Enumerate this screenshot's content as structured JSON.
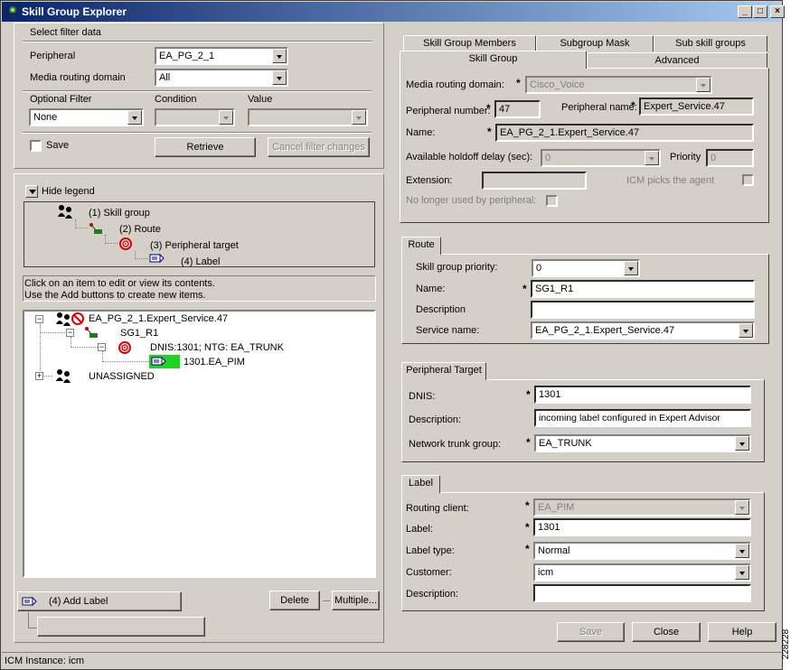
{
  "window": {
    "title": "Skill Group Explorer",
    "controls": [
      "_",
      "□",
      "×"
    ]
  },
  "filter": {
    "section_label": "Select filter data",
    "peripheral_label": "Peripheral",
    "peripheral_value": "EA_PG_2_1",
    "media_label": "Media routing domain",
    "media_value": "All",
    "optional_filter_label": "Optional Filter",
    "condition_label": "Condition",
    "value_label": "Value",
    "optional_filter_value": "None",
    "save_label": "Save",
    "retrieve_button": "Retrieve",
    "cancel_button": "Cancel filter changes"
  },
  "legend": {
    "toggle_label": "Hide legend",
    "items": [
      "(1) Skill group",
      "(2) Route",
      "(3) Peripheral target",
      "(4) Label"
    ]
  },
  "instructions": {
    "line1": "Click on an item to edit or view its contents.",
    "line2": "Use the Add buttons to create new items."
  },
  "tree": {
    "skill_group": "EA_PG_2_1.Expert_Service.47",
    "route": "SG1_R1",
    "peripheral_target": "DNIS:1301; NTG: EA_TRUNK",
    "label": "1301.EA_PIM",
    "unassigned": "UNASSIGNED"
  },
  "bottom_left": {
    "add_label_button": "(4) Add Label",
    "delete_button": "Delete",
    "multiple_button": "Multiple..."
  },
  "tabs": {
    "row1": [
      "Skill Group Members",
      "Subgroup Mask",
      "Sub skill groups"
    ],
    "row2": [
      "Skill Group",
      "Advanced"
    ]
  },
  "skill_group": {
    "media_label": "Media routing domain:",
    "media_value": "Cisco_Voice",
    "peripheral_number_label": "Peripheral number:",
    "peripheral_number_value": "47",
    "peripheral_name_label": "Peripheral name:",
    "peripheral_name_value": "Expert_Service.47",
    "name_label": "Name:",
    "name_value": "EA_PG_2_1.Expert_Service.47",
    "holdoff_label": "Available holdoff delay (sec):",
    "holdoff_value": "0",
    "priority_label": "Priority",
    "priority_value": "0",
    "extension_label": "Extension:",
    "icm_picks_label": "ICM picks the agent",
    "no_longer_label": "No longer used by peripheral:"
  },
  "route": {
    "tab_label": "Route",
    "priority_label": "Skill group priority:",
    "priority_value": "0",
    "name_label": "Name:",
    "name_value": "SG1_R1",
    "description_label": "Description",
    "description_value": "",
    "service_label": "Service name:",
    "service_value": "EA_PG_2_1.Expert_Service.47"
  },
  "peripheral_target": {
    "tab_label": "Peripheral Target",
    "dnis_label": "DNIS:",
    "dnis_value": "1301",
    "description_label": "Description:",
    "description_value": "incoming label configured in Expert Advisor",
    "trunk_label": "Network trunk group:",
    "trunk_value": "EA_TRUNK"
  },
  "label": {
    "tab_label": "Label",
    "routing_client_label": "Routing client:",
    "routing_client_value": "EA_PIM",
    "label_label": "Label:",
    "label_value": "1301",
    "type_label": "Label type:",
    "type_value": "Normal",
    "customer_label": "Customer:",
    "customer_value": "icm",
    "description_label": "Description:",
    "description_value": ""
  },
  "actions": {
    "save": "Save",
    "close": "Close",
    "help": "Help"
  },
  "status": {
    "text": "ICM Instance: icm"
  },
  "side_number": "228228",
  "required_mark": "*"
}
